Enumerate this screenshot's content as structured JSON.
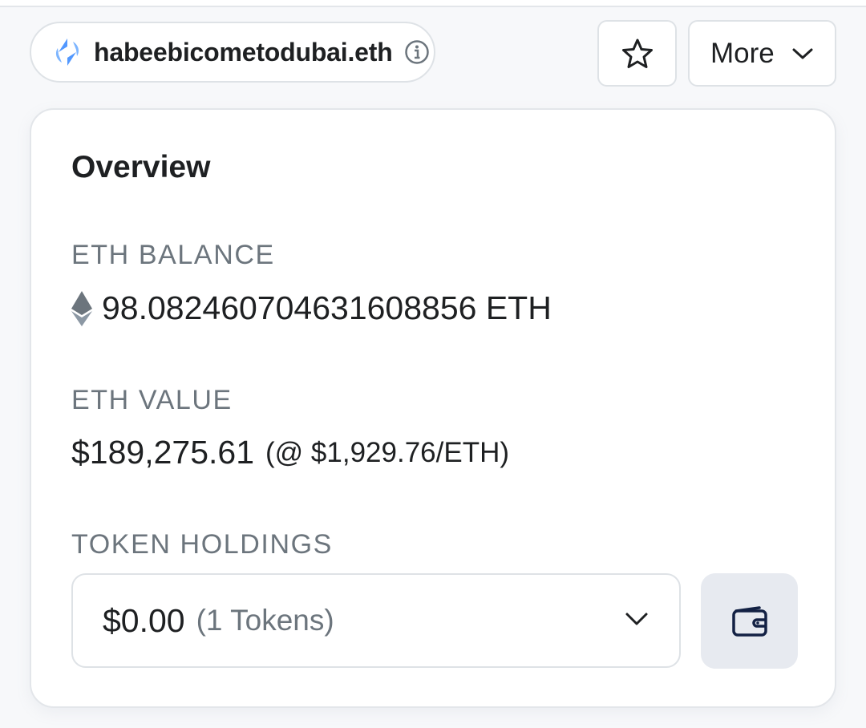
{
  "header": {
    "ens_name": "habeebicometodubai.eth",
    "more_label": "More"
  },
  "overview": {
    "title": "Overview",
    "eth_balance_label": "ETH BALANCE",
    "eth_balance_value": "98.08246070463160885 6 ETH",
    "eth_value_label": "ETH VALUE",
    "eth_value_amount": "$189,275.61",
    "eth_price": "(@ $1,929.76/ETH)",
    "token_holdings_label": "TOKEN HOLDINGS",
    "token_value": "$0.00",
    "token_count": "(1 Tokens)"
  },
  "colors": {
    "ens_blue": "#5298ff",
    "text_dark": "#1e2022",
    "text_muted": "#6c757d",
    "border": "#dee2e6",
    "wallet_bg": "#e7eaf0"
  },
  "icons": [
    "ens-logo-icon",
    "info-icon",
    "star-icon",
    "chevron-down-icon",
    "eth-diamond-icon",
    "wallet-icon"
  ]
}
